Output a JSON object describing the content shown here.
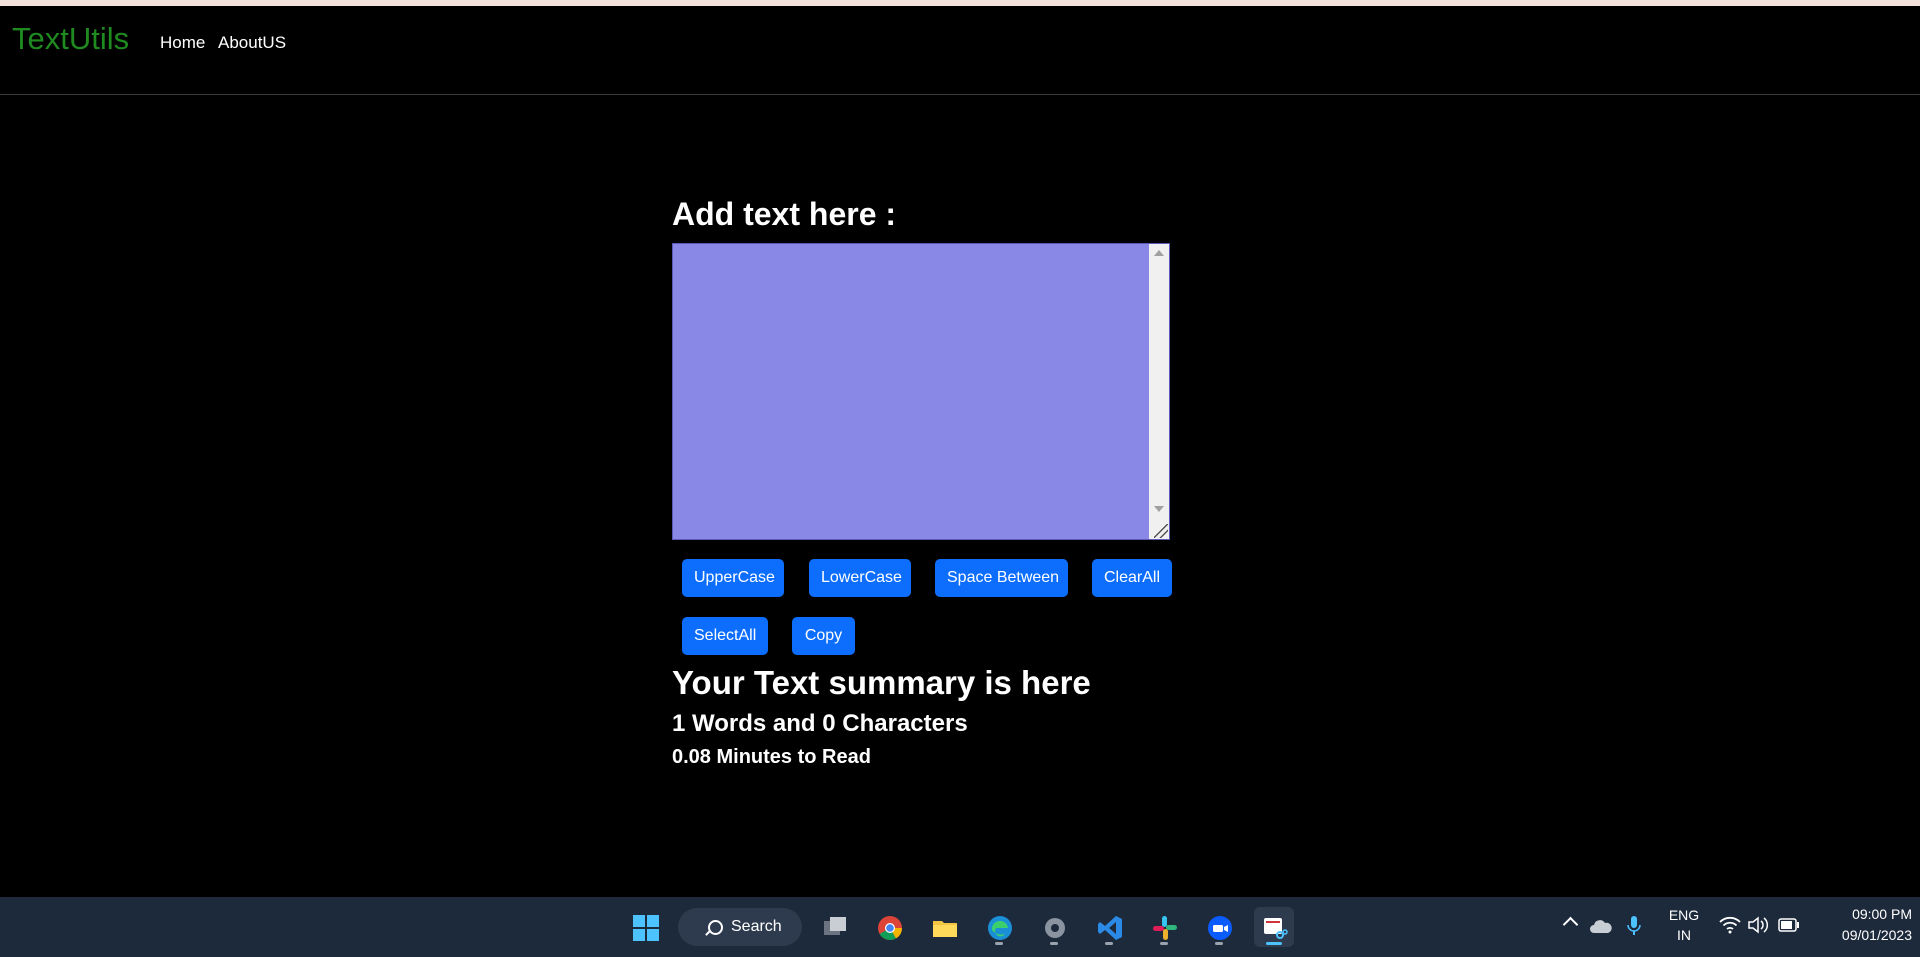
{
  "navbar": {
    "brand": "TextUtils",
    "links": [
      "Home",
      "AboutUS"
    ]
  },
  "main": {
    "heading": "Add text here :",
    "textarea_value": "",
    "buttons": [
      "UpperCase",
      "LowerCase",
      "Space Between",
      "ClearAll",
      "SelectAll",
      "Copy"
    ],
    "summary_title": "Your Text summary is here",
    "summary_counts": "1 Words and 0 Characters",
    "summary_read": "0.08 Minutes to Read"
  },
  "colors": {
    "brand": "#1f8a1f",
    "textarea_bg": "#8a88e6",
    "button_bg": "#0d6efd",
    "background": "#000000"
  },
  "taskbar": {
    "search_label": "Search",
    "apps": [
      "windows-start-icon",
      "task-view-icon",
      "chrome-icon",
      "file-explorer-icon",
      "edge-icon",
      "settings-icon",
      "vscode-icon",
      "slack-icon",
      "zoom-icon",
      "snipping-tool-icon"
    ],
    "lang_line1": "ENG",
    "lang_line2": "IN",
    "time": "09:00 PM",
    "date": "09/01/2023"
  }
}
